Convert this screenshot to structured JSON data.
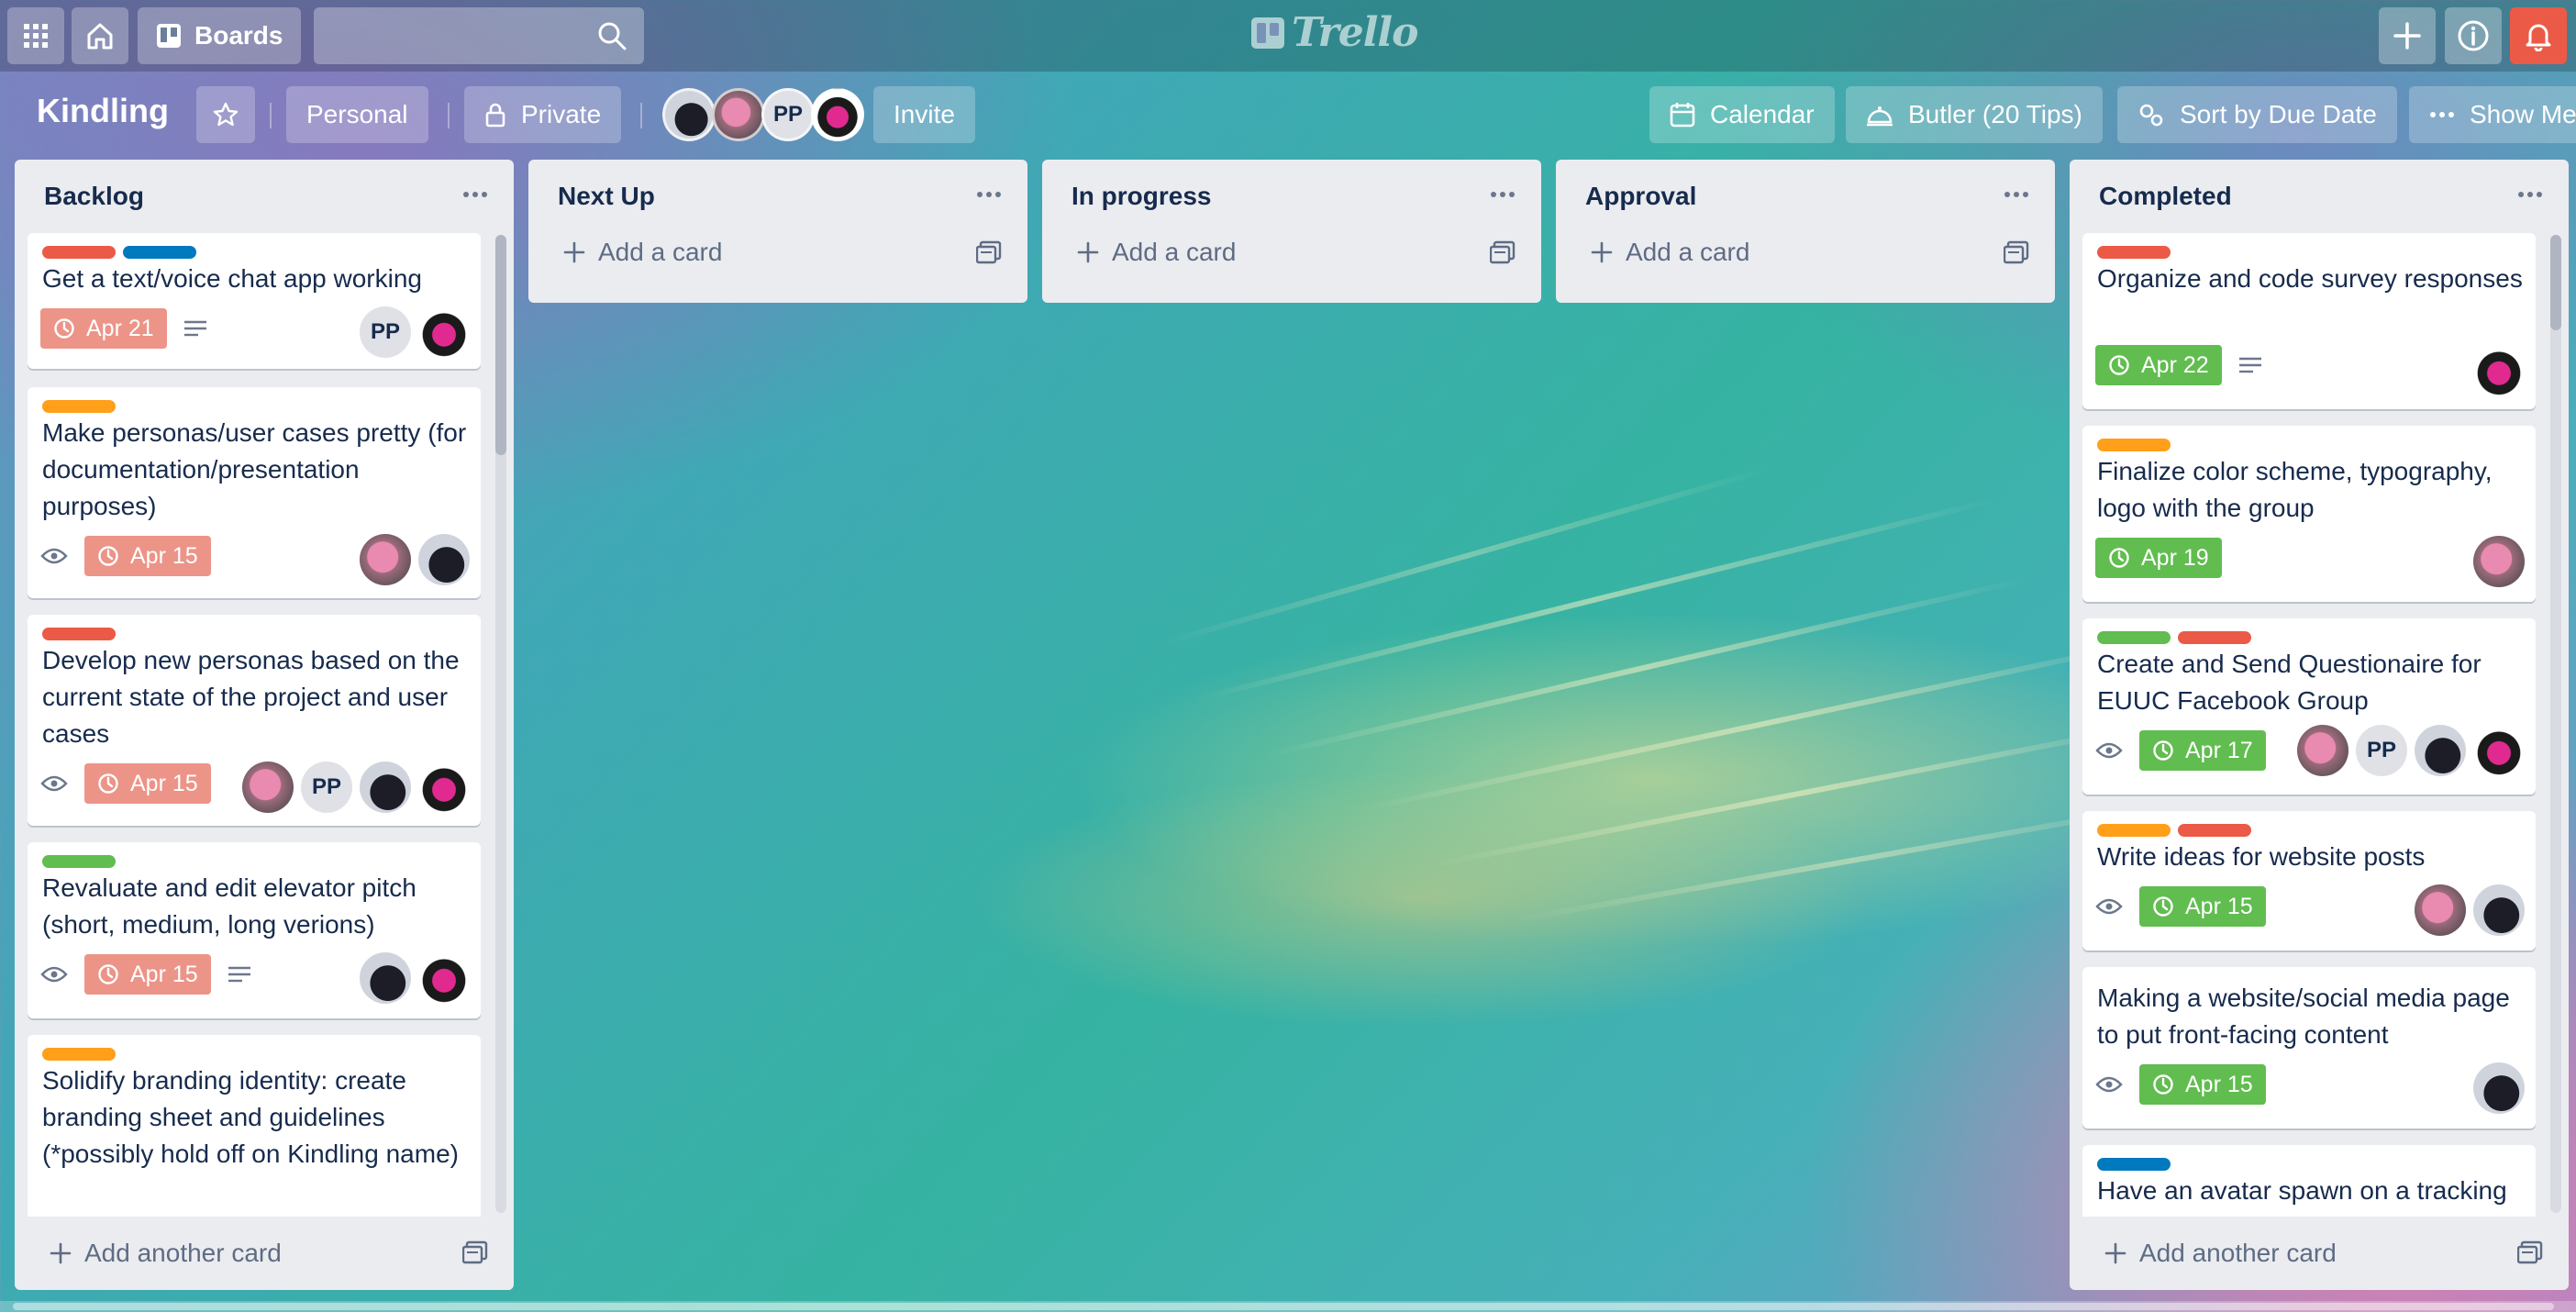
{
  "topbar": {
    "boards_label": "Boards",
    "search_placeholder": "",
    "logo_text": "Trello"
  },
  "board": {
    "title": "Kindling",
    "team_label": "Personal",
    "visibility_label": "Private",
    "invite_label": "Invite",
    "calendar_label": "Calendar",
    "butler_label": "Butler (20 Tips)",
    "sort_label": "Sort by Due Date",
    "show_menu_label": "Show Menu",
    "member_initials": "PP"
  },
  "labels_colors": {
    "red": "#eb5a46",
    "blue": "#0079bf",
    "orange": "#ff9f1a",
    "green": "#61bd4f"
  },
  "lists": [
    {
      "title": "Backlog",
      "add_label": "Add another card",
      "cards": [
        {
          "title": "Get a text/voice chat app working",
          "labels": [
            "red",
            "blue"
          ],
          "watch": false,
          "due": "Apr 21",
          "due_status": "overdue",
          "description": true,
          "members": [
            "PP",
            "demon"
          ]
        },
        {
          "title": "Make personas/user cases pretty (for documentation/presentation purposes)",
          "labels": [
            "orange"
          ],
          "watch": true,
          "due": "Apr 15",
          "due_status": "overdue",
          "description": false,
          "members": [
            "pink",
            "cat"
          ]
        },
        {
          "title": "Develop new personas based on the current state of the project and user cases",
          "labels": [
            "red"
          ],
          "watch": true,
          "due": "Apr 15",
          "due_status": "overdue",
          "description": false,
          "members": [
            "pink",
            "PP",
            "cat",
            "demon"
          ]
        },
        {
          "title": "Revaluate and edit elevator pitch (short, medium, long verions)",
          "labels": [
            "green"
          ],
          "watch": true,
          "due": "Apr 15",
          "due_status": "overdue",
          "description": true,
          "members": [
            "cat",
            "demon"
          ]
        },
        {
          "title": "Solidify branding identity: create branding sheet and guidelines (*possibly hold off on Kindling name)",
          "labels": [
            "orange"
          ]
        }
      ]
    },
    {
      "title": "Next Up",
      "add_label": "Add a card",
      "cards": []
    },
    {
      "title": "In progress",
      "add_label": "Add a card",
      "cards": []
    },
    {
      "title": "Approval",
      "add_label": "Add a card",
      "cards": []
    },
    {
      "title": "Completed",
      "add_label": "Add another card",
      "cards": [
        {
          "title": "Organize and code survey responses",
          "labels": [
            "red"
          ],
          "watch": false,
          "due": "Apr 22",
          "due_status": "complete",
          "description": true,
          "members": [
            "demon"
          ]
        },
        {
          "title": "Finalize color scheme, typography, logo with the group",
          "labels": [
            "orange"
          ],
          "watch": false,
          "due": "Apr 19",
          "due_status": "complete",
          "description": false,
          "members": [
            "pink"
          ]
        },
        {
          "title": "Create and Send Questionaire for EUUC Facebook Group",
          "labels": [
            "green",
            "red"
          ],
          "watch": true,
          "due": "Apr 17",
          "due_status": "complete",
          "description": false,
          "members": [
            "pink",
            "PP",
            "cat",
            "demon"
          ]
        },
        {
          "title": "Write ideas for website posts",
          "labels": [
            "orange",
            "red"
          ],
          "watch": true,
          "due": "Apr 15",
          "due_status": "complete",
          "description": false,
          "members": [
            "pink",
            "cat"
          ]
        },
        {
          "title": "Making a website/social media page to put front-facing content",
          "labels": [],
          "watch": true,
          "due": "Apr 15",
          "due_status": "complete",
          "description": false,
          "members": [
            "cat"
          ]
        },
        {
          "title": "Have an avatar spawn on a tracking plane on a button press",
          "labels": [
            "blue"
          ]
        }
      ]
    }
  ]
}
